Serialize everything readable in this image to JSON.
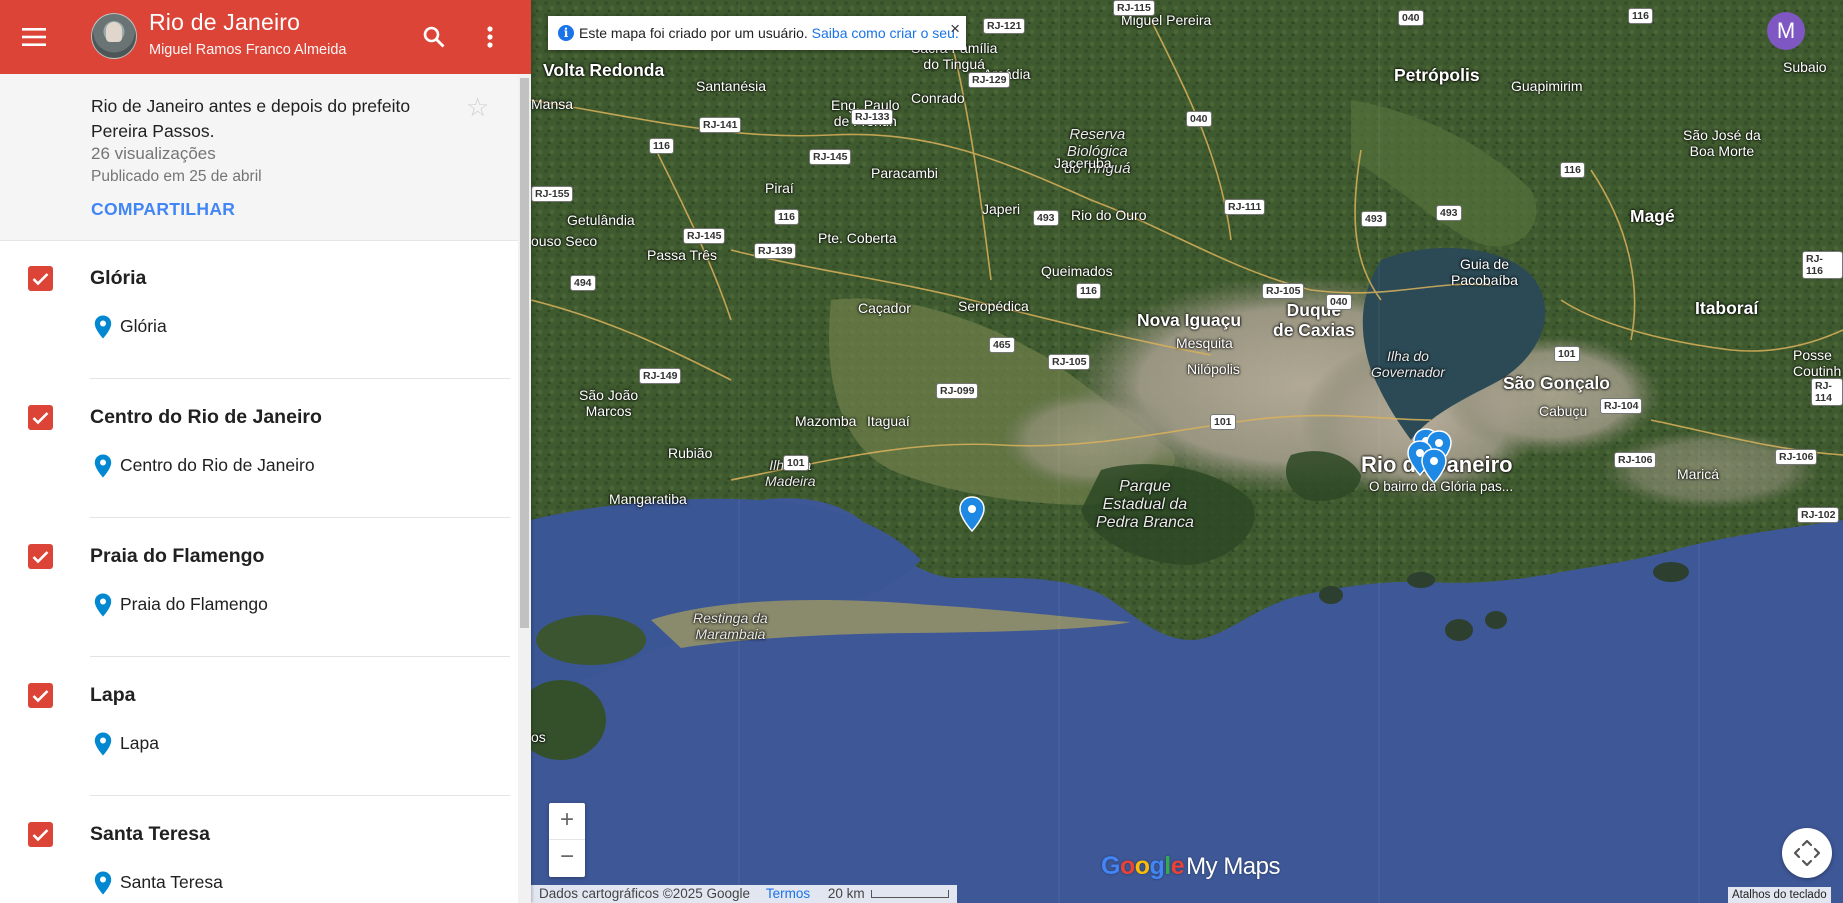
{
  "header": {
    "title": "Rio de Janeiro",
    "author": "Miguel Ramos Franco Almeida",
    "bg_color": "#db4437"
  },
  "info": {
    "description": "Rio de Janeiro antes e depois do prefeito Pereira Passos.",
    "views": "26 visualizações",
    "published": "Publicado em 25 de abril",
    "share_label": "COMPARTILHAR",
    "share_color": "#4285f4"
  },
  "layers": [
    {
      "title": "Glória",
      "checked": true,
      "place": "Glória"
    },
    {
      "title": "Centro do Rio de Janeiro",
      "checked": true,
      "place": "Centro do Rio de Janeiro"
    },
    {
      "title": "Praia do Flamengo",
      "checked": true,
      "place": "Praia do Flamengo"
    },
    {
      "title": "Lapa",
      "checked": true,
      "place": "Lapa"
    },
    {
      "title": "Santa Teresa",
      "checked": true,
      "place": "Santa Teresa"
    }
  ],
  "map": {
    "notice_text": "Este mapa foi criado por um usuário.",
    "notice_link": "Saiba como criar o seu.",
    "user_initial": "M",
    "zoom_in": "+",
    "zoom_out": "−",
    "logo_text": "Google My Maps",
    "attribution": "Dados cartográficos ©2025 Google",
    "terms": "Termos",
    "scale": "20 km",
    "shortcuts": "Atalhos do teclado",
    "pin_label": "O bairro da Glória pas...",
    "places": {
      "volta_redonda": "Volta Redonda",
      "petropolis": "Petrópolis",
      "mage": "Magé",
      "nova_iguacu": "Nova Iguaçu",
      "duque_de_caxias": "Duque\nde Caxias",
      "rio_de_janeiro": "Rio de Janeiro",
      "sao_goncalo": "São Gonçalo",
      "itaborai": "Itaboraí",
      "santanesia": "Santanésia",
      "eng_paulo": "Eng. Paulo\nde Frontin",
      "conrado": "Conrado",
      "arcadia": "Arcádia",
      "sacra_familia": "Sacra Família\ndo Tinguá",
      "miguel_pereira": "Miguel Pereira",
      "reserva": "Reserva\nBiológica\ndo Tinguá",
      "jaceruba": "Jaceruba",
      "paracambi": "Paracambi",
      "pirai": "Piraí",
      "getulandia": "Getulândia",
      "passa_tres": "Passa Três",
      "pte_coberta": "Pte. Coberta",
      "japeri": "Japeri",
      "rio_do_ouro": "Rio do Ouro",
      "queimados": "Queimados",
      "cacador": "Caçador",
      "seropedica": "Seropédica",
      "mesquita": "Mesquita",
      "nilopolis": "Nilópolis",
      "guia_de_pacobaiba": "Guia de\nPacobaíba",
      "ilha_do_governador": "Ilha do\nGovernador",
      "sao_joao_marcos": "São João\nMarcos",
      "rubiao": "Rubião",
      "mazomba": "Mazomba",
      "itaguai": "Itaguaí",
      "ilha_da_madeira": "Ilha da\nMadeira",
      "mangaratiba": "Mangaratiba",
      "parque": "Parque\nEstadual da\nPedra Branca",
      "restinga": "Restinga da\nMarambaia",
      "guapimirim": "Guapimirim",
      "sao_jose_boa_morte": "São José da\nBoa Morte",
      "cabucu": "Cabuçu",
      "marica": "Maricá",
      "posse": "Posse\nCoutinh",
      "subaio": "Subaio",
      "mansa": "Mansa",
      "couso_seco": "ouso Seco",
      "os": "os"
    },
    "roads": [
      "RJ-121",
      "RJ-115",
      "040",
      "116",
      "RJ-129",
      "040",
      "RJ-133",
      "RJ-141",
      "116",
      "RJ-145",
      "116",
      "RJ-145",
      "RJ-139",
      "494",
      "493",
      "RJ-111",
      "493",
      "493",
      "116",
      "RJ-116",
      "RJ-105",
      "040",
      "465",
      "RJ-105",
      "RJ-099",
      "RJ-149",
      "101",
      "101",
      "RJ-104",
      "RJ-106",
      "RJ-106",
      "RJ-114",
      "101",
      "RJ-102",
      "116",
      "RJ-155"
    ]
  }
}
